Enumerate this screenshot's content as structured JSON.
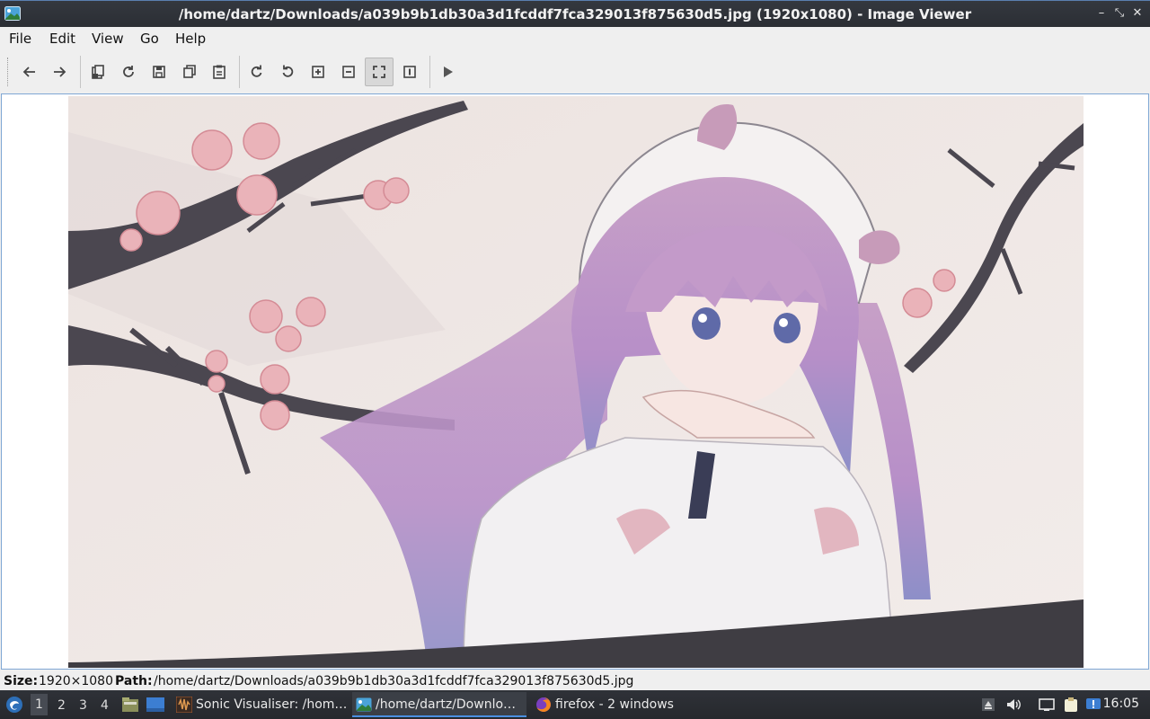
{
  "window": {
    "title": "/home/dartz/Downloads/a039b9b1db30a3d1fcddf7fca329013f875630d5.jpg (1920x1080) - Image Viewer",
    "app_icon": "image-viewer-icon",
    "controls": {
      "minimize": "–",
      "maximize": "⤡",
      "close": "✕"
    }
  },
  "menubar": {
    "items": [
      "File",
      "Edit",
      "View",
      "Go",
      "Help"
    ]
  },
  "toolbar": {
    "buttons": [
      {
        "icon": "arrow-left-icon",
        "tooltip": "Previous"
      },
      {
        "icon": "arrow-right-icon",
        "tooltip": "Next"
      },
      {
        "icon": "open-file-icon",
        "tooltip": "Open"
      },
      {
        "icon": "reload-icon",
        "tooltip": "Reload"
      },
      {
        "icon": "save-icon",
        "tooltip": "Save"
      },
      {
        "icon": "copy-icon",
        "tooltip": "Copy"
      },
      {
        "icon": "paste-icon",
        "tooltip": "Paste"
      },
      {
        "icon": "rotate-clockwise-icon",
        "tooltip": "Rotate clockwise"
      },
      {
        "icon": "rotate-counterclockwise-icon",
        "tooltip": "Rotate counterclockwise"
      },
      {
        "icon": "zoom-in-icon",
        "tooltip": "Zoom in"
      },
      {
        "icon": "zoom-out-icon",
        "tooltip": "Zoom out"
      },
      {
        "icon": "fit-window-icon",
        "tooltip": "Fit",
        "active": true
      },
      {
        "icon": "original-size-icon",
        "tooltip": "Original size"
      },
      {
        "icon": "slideshow-icon",
        "tooltip": "Slideshow"
      }
    ]
  },
  "image": {
    "description_icon": "anime-artwork-image"
  },
  "statusbar": {
    "size_label": "Size:",
    "size_value": "1920×1080",
    "path_label": "Path:",
    "path_value": "/home/dartz/Downloads/a039b9b1db30a3d1fcddf7fca329013f875630d5.jpg"
  },
  "taskbar": {
    "desktops": [
      "1",
      "2",
      "3",
      "4"
    ],
    "active_desktop": "1",
    "tasks": [
      {
        "label": "Sonic Visualiser: /hom…",
        "icon": "sonic-visualiser-icon"
      },
      {
        "label": "/home/dartz/Downlo…",
        "icon": "image-viewer-icon",
        "active": true
      },
      {
        "label": "firefox - 2 windows",
        "icon": "firefox-icon"
      }
    ],
    "clock": "16:05"
  },
  "colors": {
    "titlebar": "#2b2e34",
    "taskbar": "#26282d",
    "accent": "#4a8fe0",
    "viewer_border": "#7fa7d4"
  }
}
